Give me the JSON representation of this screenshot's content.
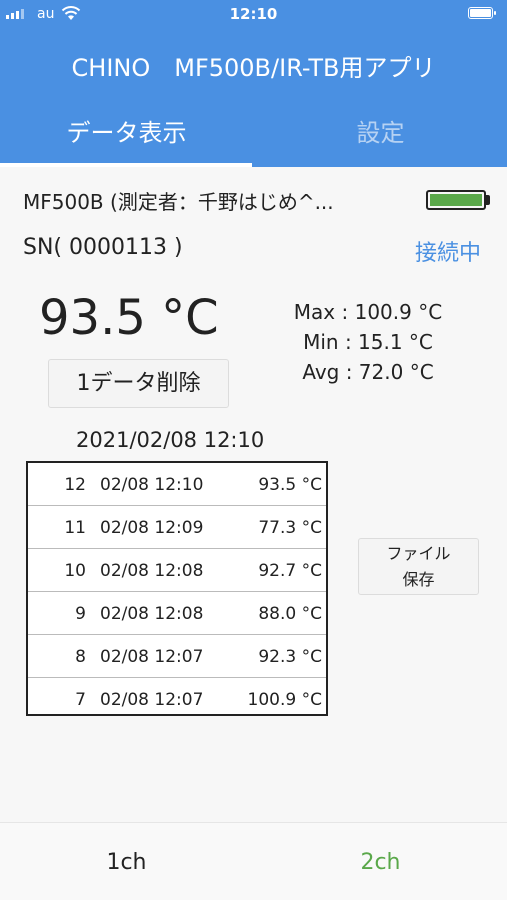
{
  "status_bar": {
    "carrier": "au",
    "time": "12:10"
  },
  "app": {
    "title": "CHINO　MF500B/IR-TB用アプリ"
  },
  "tabs": [
    {
      "label": "データ表示",
      "active": true
    },
    {
      "label": "設定",
      "active": false
    }
  ],
  "device": {
    "name_line": "MF500B (測定者：千野はじめ^...",
    "serial": "SN( 0000113 )",
    "connection": "接続中",
    "battery_icon": "battery-full-icon"
  },
  "reading": {
    "current": "93.5 °C",
    "max": "Max : 100.9 °C",
    "min": "Min : 15.1 °C",
    "avg": "Avg : 72.0 °C"
  },
  "actions": {
    "delete_label": "1データ削除",
    "save_line1": "ファイル",
    "save_line2": "保存"
  },
  "timestamp": "2021/02/08 12:10",
  "log": [
    {
      "no": "12",
      "time": "02/08 12:10",
      "value": "93.5 °C"
    },
    {
      "no": "11",
      "time": "02/08 12:09",
      "value": "77.3 °C"
    },
    {
      "no": "10",
      "time": "02/08 12:08",
      "value": "92.7 °C"
    },
    {
      "no": "9",
      "time": "02/08 12:08",
      "value": "88.0 °C"
    },
    {
      "no": "8",
      "time": "02/08 12:07",
      "value": "92.3 °C"
    },
    {
      "no": "7",
      "time": "02/08 12:07",
      "value": "100.9 °C"
    }
  ],
  "bottom_tabs": [
    {
      "label": "1ch"
    },
    {
      "label": "2ch"
    }
  ],
  "colors": {
    "header": "#4a90e2",
    "accent_blue": "#4a90e2",
    "accent_green": "#5aa84a"
  }
}
